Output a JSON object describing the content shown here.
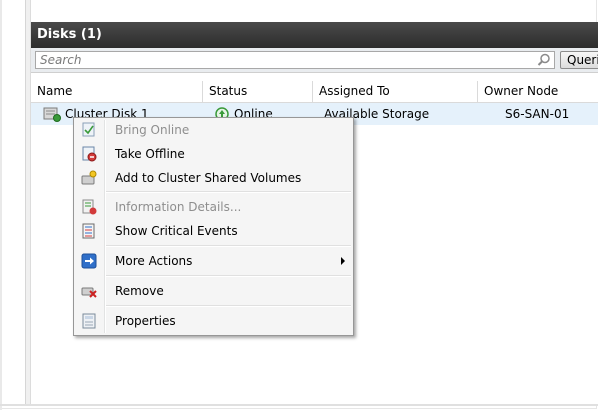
{
  "panel": {
    "title": "Disks (1)"
  },
  "search": {
    "placeholder": "Search",
    "query_label": "Queries"
  },
  "columns": [
    "Name",
    "Status",
    "Assigned To",
    "Owner Node"
  ],
  "disks": [
    {
      "name": "Cluster Disk 1",
      "status": "Online",
      "assigned_to": "Available Storage",
      "owner_node": "S6-SAN-01"
    }
  ],
  "context_menu": {
    "items": [
      {
        "label": "Bring Online",
        "icon": "bring-online-icon",
        "enabled": false
      },
      {
        "label": "Take Offline",
        "icon": "take-offline-icon",
        "enabled": true
      },
      {
        "label": "Add to Cluster Shared Volumes",
        "icon": "add-csv-icon",
        "enabled": true
      },
      {
        "label": "Information Details...",
        "icon": "information-details-icon",
        "enabled": false
      },
      {
        "label": "Show Critical Events",
        "icon": "critical-events-icon",
        "enabled": true
      },
      {
        "label": "More Actions",
        "icon": "more-actions-icon",
        "enabled": true,
        "has_submenu": true
      },
      {
        "label": "Remove",
        "icon": "remove-icon",
        "enabled": true
      },
      {
        "label": "Properties",
        "icon": "properties-icon",
        "enabled": true
      }
    ]
  },
  "colors": {
    "header_bg": "#333333",
    "selected_row": "#e5f1fb",
    "online_green": "#3a9a3a",
    "remove_red": "#cc2222",
    "action_blue": "#2f6fc9"
  }
}
